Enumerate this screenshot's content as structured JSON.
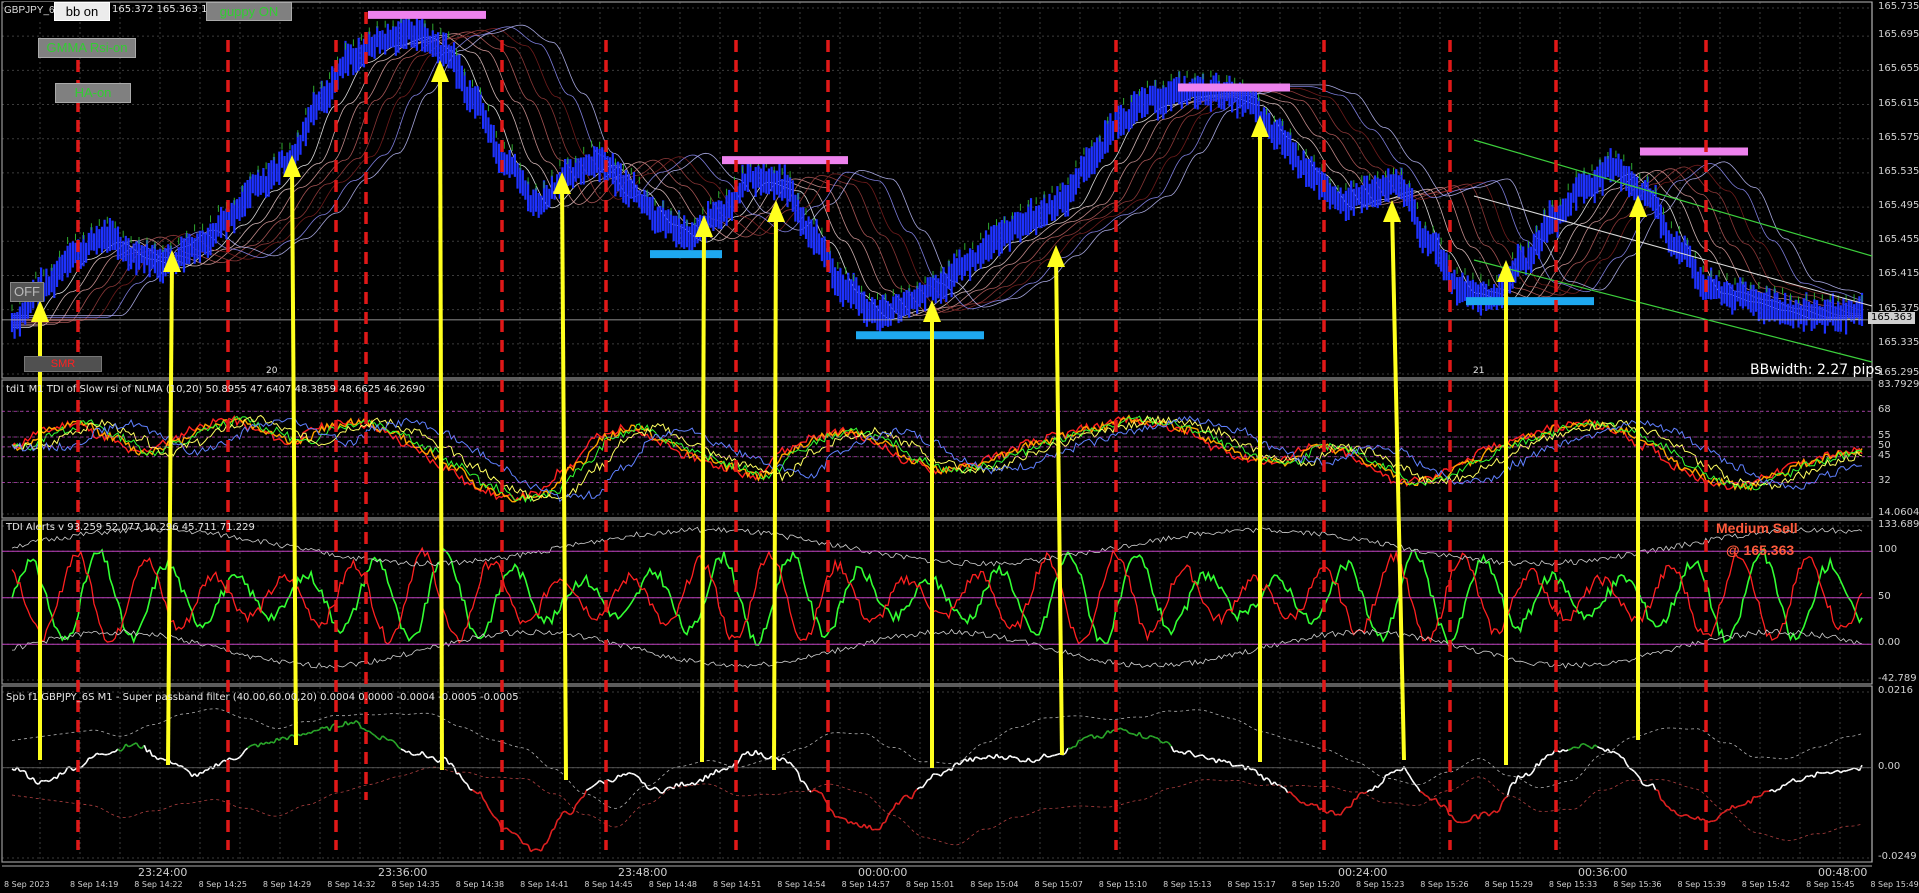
{
  "window": {
    "symbol_label": "GBPJPY_6",
    "quote_text": "165.372 165.363 165"
  },
  "buttons": {
    "bb": "bb on",
    "guppy": "guppy ON",
    "gmma": "GMMA Rsi-on",
    "ha": "HA-on",
    "off": "OFF",
    "smr": "SMR"
  },
  "panes": {
    "main": {
      "bbwidth": "BBwidth: 2.27 pips",
      "current_price": "165.363",
      "marker_left": "20",
      "marker_right": "21"
    },
    "tdi": {
      "label": "tdi1 M1 TDI of Slow rsi of NLMA (10,20) 50.8955 47.6407 48.3859 48.6625 46.2690"
    },
    "alerts": {
      "label": "TDI Alerts v 93.259 52.077 10.296 45.711 71.229",
      "signal": "Medium Sell",
      "signal_price": "@ 165.363"
    },
    "filter": {
      "label": "Spb f1 GBPJPY_6S M1 - Super passband filter (40.00,60.00,20) 0.0004 0.0000 -0.0004 -0.0005 -0.0005"
    }
  },
  "colors": {
    "background": "#000000",
    "grid": "#3c3c3c",
    "price_blue": "#1e32ff",
    "arrow": "#ffff1e",
    "signal_line": "#e01818",
    "resistance": "#ee82ee",
    "support": "#1ea8f0",
    "tdi_green": "#32ff32",
    "tdi_red": "#ff2020",
    "filter_white": "#ffffff"
  },
  "chart_data": [
    {
      "type": "line",
      "title": "GBPJPY M1",
      "y_ticks": [
        "165.735",
        "165.695",
        "165.655",
        "165.615",
        "165.575",
        "165.535",
        "165.495",
        "165.455",
        "165.415",
        "165.375",
        "165.335",
        "165.295"
      ],
      "ylim": [
        165.295,
        165.735
      ],
      "x_ticks": [
        "23:24:00",
        "23:36:00",
        "23:48:00",
        "00:00:00",
        "00:24:00",
        "00:36:00",
        "00:48:00"
      ],
      "series": [
        {
          "values": [
            165.36,
            165.4,
            165.44,
            165.46,
            165.44,
            165.43,
            165.45,
            165.48,
            165.52,
            165.55,
            165.62,
            165.67,
            165.69,
            165.7,
            165.68,
            165.62,
            165.55,
            165.5,
            165.53,
            165.55,
            165.52,
            165.48,
            165.46,
            165.49,
            165.53,
            165.52,
            165.46,
            165.4,
            165.37,
            165.38,
            165.4,
            165.43,
            165.46,
            165.48,
            165.5,
            165.55,
            165.6,
            165.62,
            165.63,
            165.63,
            165.62,
            165.58,
            165.54,
            165.5,
            165.51,
            165.52,
            165.45,
            165.4,
            165.39,
            165.43,
            165.48,
            165.52,
            165.54,
            165.51,
            165.45,
            165.4,
            165.39,
            165.38,
            165.37,
            165.37,
            165.37
          ]
        }
      ],
      "resistance_levels": [
        165.72,
        165.635,
        165.55,
        165.56
      ],
      "support_levels": [
        165.44,
        165.345,
        165.385
      ],
      "current_price": 165.363
    },
    {
      "type": "line",
      "y_ticks": [
        "83.7929",
        "68",
        "55",
        "50",
        "45",
        "32",
        "14.0604"
      ],
      "ylim": [
        14.0604,
        83.7929
      ],
      "levels": [
        68,
        55,
        50,
        45,
        32
      ],
      "series": [
        {
          "values": [
            50,
            58,
            62,
            55,
            47,
            52,
            60,
            64,
            58,
            52,
            60,
            63,
            58,
            49,
            40,
            30,
            24,
            26,
            40,
            55,
            60,
            52,
            45,
            40,
            35,
            48,
            55,
            58,
            52,
            43,
            38,
            40,
            46,
            52,
            56,
            60,
            64,
            62,
            58,
            50,
            44,
            42,
            50,
            48,
            40,
            32,
            34,
            42,
            50,
            55,
            60,
            62,
            58,
            50,
            40,
            32,
            30,
            36,
            42,
            46,
            48
          ]
        }
      ]
    },
    {
      "type": "line",
      "y_ticks": [
        "133.689",
        "100",
        "50",
        "0.00",
        "-42.789"
      ],
      "ylim": [
        -42.789,
        133.689
      ],
      "levels": [
        100,
        50,
        0
      ]
    },
    {
      "type": "line",
      "y_ticks": [
        "0.0216",
        "0.00",
        "-0.0249"
      ],
      "ylim": [
        -0.0249,
        0.0216
      ],
      "series": [
        {
          "values": [
            0.0,
            -0.004,
            0.0,
            0.004,
            0.006,
            0.002,
            -0.002,
            0.002,
            0.006,
            0.008,
            0.01,
            0.012,
            0.008,
            0.004,
            0.002,
            -0.006,
            -0.016,
            -0.022,
            -0.012,
            -0.004,
            -0.002,
            -0.006,
            -0.004,
            -0.001,
            0.004,
            0.002,
            -0.006,
            -0.014,
            -0.016,
            -0.008,
            -0.002,
            0.002,
            0.003,
            0.002,
            0.004,
            0.008,
            0.01,
            0.008,
            0.004,
            0.002,
            0.0,
            -0.004,
            -0.01,
            -0.012,
            -0.006,
            0.0,
            -0.008,
            -0.014,
            -0.012,
            -0.002,
            0.004,
            0.006,
            0.004,
            -0.004,
            -0.012,
            -0.014,
            -0.01,
            -0.006,
            -0.003,
            -0.001,
            0.0
          ]
        }
      ]
    }
  ],
  "x_sub_labels": [
    "8 Sep 14:19",
    "8 Sep 14:22",
    "8 Sep 14:25",
    "8 Sep 14:29",
    "8 Sep 14:32",
    "8 Sep 14:35",
    "8 Sep 14:38",
    "8 Sep 14:41",
    "8 Sep 14:45",
    "8 Sep 14:48",
    "8 Sep 14:51",
    "8 Sep 14:54",
    "8 Sep 14:57",
    "8 Sep 15:01",
    "8 Sep 15:04",
    "8 Sep 15:07",
    "8 Sep 15:10",
    "8 Sep 15:13",
    "8 Sep 15:17",
    "8 Sep 15:20",
    "8 Sep 15:23",
    "8 Sep 15:26",
    "8 Sep 15:29",
    "8 Sep 15:33",
    "8 Sep 15:36",
    "8 Sep 15:39",
    "8 Sep 15:42",
    "8 Sep 15:45",
    "8 Sep 15:49"
  ],
  "x_first_label": "8 Sep 2023"
}
